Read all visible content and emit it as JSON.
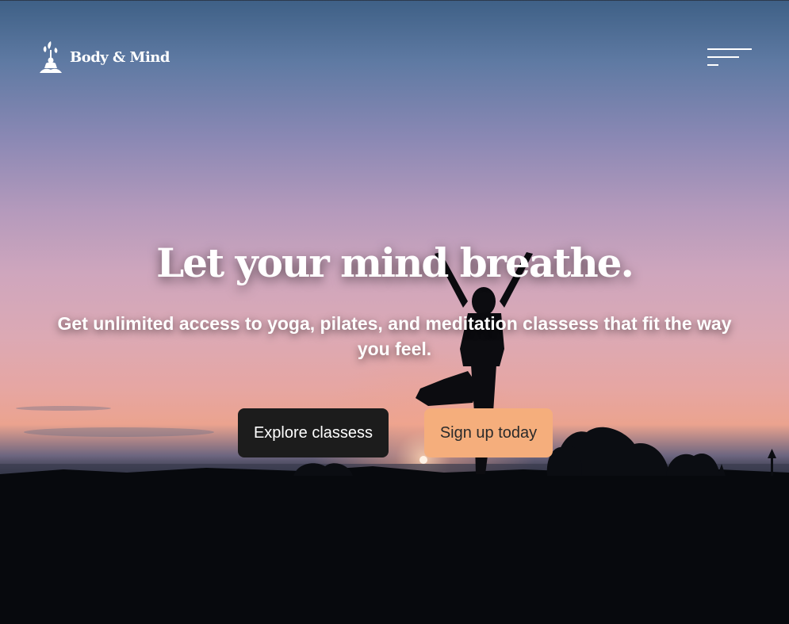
{
  "brand": {
    "name": "Body & Mind"
  },
  "header": {
    "menu_icon": "hamburger-menu-icon"
  },
  "hero": {
    "headline": "Let your mind breathe.",
    "subheadline": "Get unlimited access to yoga, pilates, and meditation classess that fit the way you feel.",
    "explore_label": "Explore classess",
    "signup_label": "Sign up today"
  },
  "colors": {
    "explore_button": "#1c1c1c",
    "signup_button": "#f5ae7c",
    "text": "#ffffff"
  }
}
